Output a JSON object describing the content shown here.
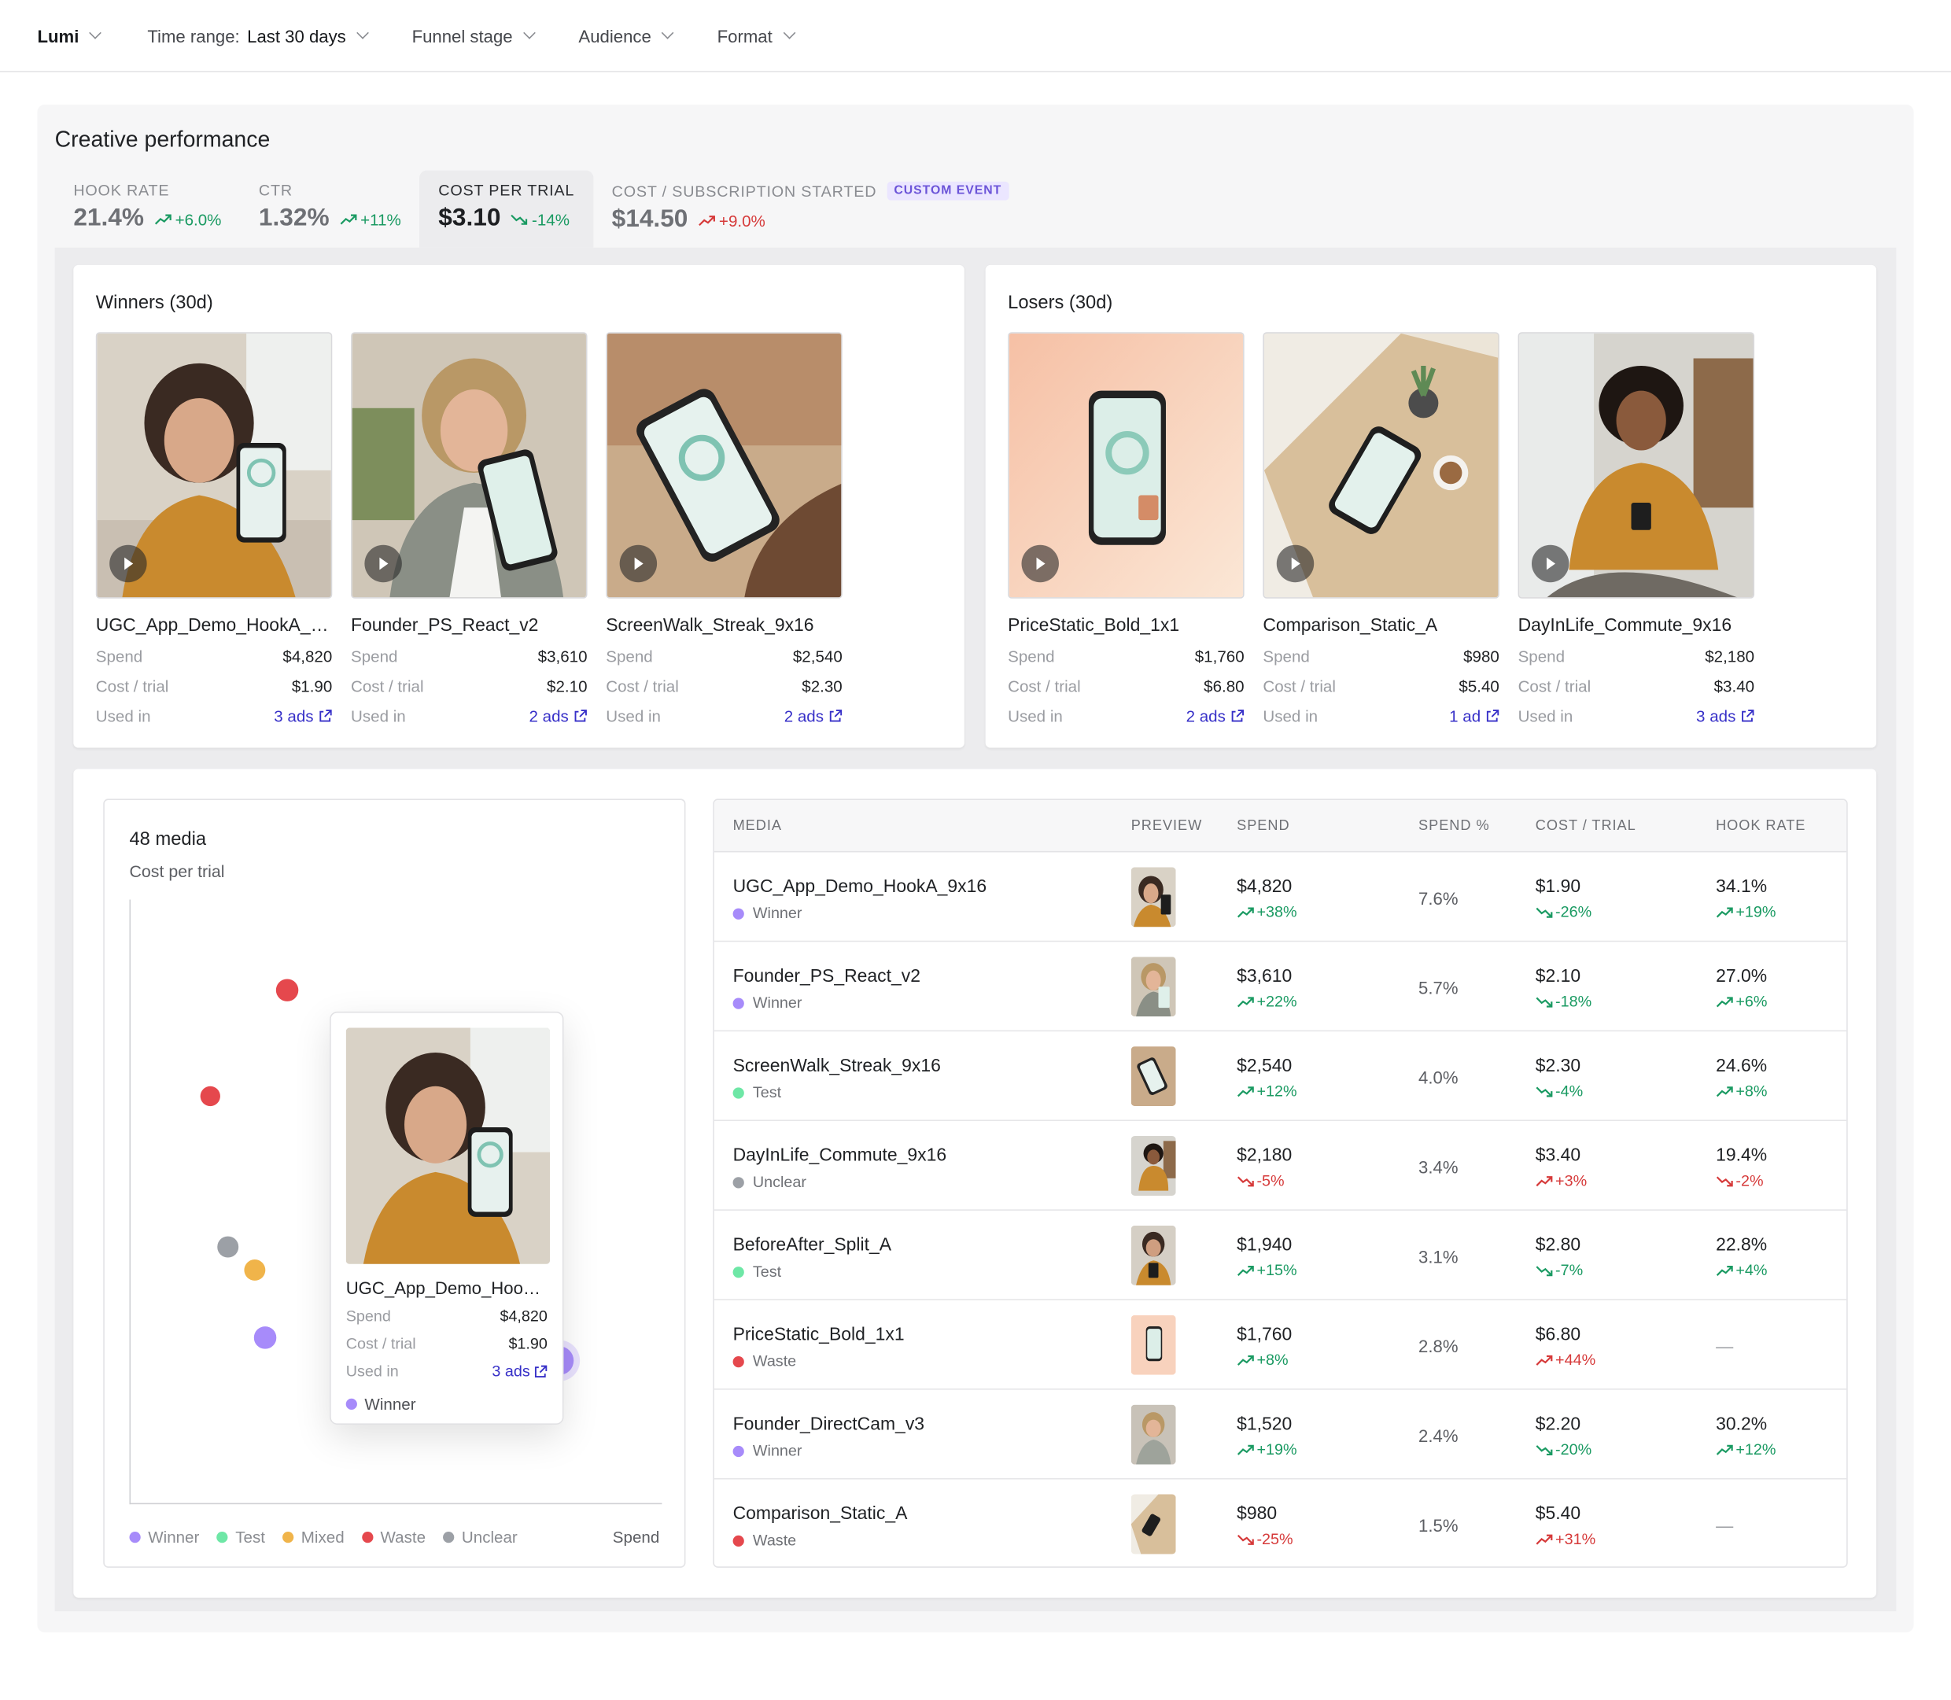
{
  "topbar": {
    "brand": "Lumi",
    "time_range_label": "Time range:",
    "time_range_value": "Last 30 days",
    "funnel_stage": "Funnel stage",
    "audience": "Audience",
    "format": "Format"
  },
  "panel": {
    "title": "Creative performance"
  },
  "metrics": [
    {
      "label": "HOOK RATE",
      "value": "21.4%",
      "delta": "+6.0%"
    },
    {
      "label": "CTR",
      "value": "1.32%",
      "delta": "+11%"
    },
    {
      "label": "COST PER TRIAL",
      "value": "$3.10",
      "delta": "-14%"
    },
    {
      "label": "COST / SUBSCRIPTION STARTED",
      "badge": "CUSTOM EVENT",
      "value": "$14.50",
      "delta": "+9.0%"
    }
  ],
  "labels": {
    "spend": "Spend",
    "cost_trial": "Cost / trial",
    "used_in": "Used in"
  },
  "winners": {
    "title": "Winners (30d)",
    "items": [
      {
        "name": "UGC_App_Demo_HookA_9x16",
        "spend": "$4,820",
        "cost": "$1.90",
        "used": "3 ads"
      },
      {
        "name": "Founder_PS_React_v2",
        "spend": "$3,610",
        "cost": "$2.10",
        "used": "2 ads"
      },
      {
        "name": "ScreenWalk_Streak_9x16",
        "spend": "$2,540",
        "cost": "$2.30",
        "used": "2 ads"
      }
    ]
  },
  "losers": {
    "title": "Losers (30d)",
    "items": [
      {
        "name": "PriceStatic_Bold_1x1",
        "spend": "$1,760",
        "cost": "$6.80",
        "used": "2 ads"
      },
      {
        "name": "Comparison_Static_A",
        "spend": "$980",
        "cost": "$5.40",
        "used": "1 ad"
      },
      {
        "name": "DayInLife_Commute_9x16",
        "spend": "$2,180",
        "cost": "$3.40",
        "used": "3 ads"
      }
    ]
  },
  "scatter": {
    "title": "48 media",
    "subtitle": "Cost per trial",
    "x_label": "Spend",
    "legend": [
      "Winner",
      "Test",
      "Mixed",
      "Waste",
      "Unclear"
    ],
    "colors": {
      "Winner": "#a78bfa",
      "Test": "#6ee7a6",
      "Mixed": "#f0b44a",
      "Waste": "#e5484d",
      "Unclear": "#9ca0a6"
    },
    "tooltip": {
      "name": "UGC_App_Demo_HookA_9x16",
      "spend": "$4,820",
      "cost": "$1.90",
      "used": "3 ads",
      "status": "Winner"
    }
  },
  "chart_data": {
    "type": "scatter",
    "title": "48 media",
    "ylabel": "Cost per trial",
    "xlabel": "Spend",
    "legend": [
      "Winner",
      "Test",
      "Mixed",
      "Waste",
      "Unclear"
    ],
    "series": [
      {
        "name": "Winner",
        "points": [
          {
            "x": 4820,
            "y": 1.9
          },
          {
            "x": 1520,
            "y": 2.2
          }
        ]
      },
      {
        "name": "Mixed",
        "points": [
          {
            "x": 1400,
            "y": 3.1
          }
        ]
      },
      {
        "name": "Unclear",
        "points": [
          {
            "x": 1100,
            "y": 3.4
          }
        ]
      },
      {
        "name": "Waste",
        "points": [
          {
            "x": 900,
            "y": 5.4
          },
          {
            "x": 1760,
            "y": 6.8
          }
        ]
      }
    ]
  },
  "table": {
    "headers": {
      "media": "MEDIA",
      "preview": "PREVIEW",
      "spend": "SPEND",
      "spend_pct": "SPEND %",
      "cost": "COST / TRIAL",
      "hook": "HOOK RATE"
    },
    "rows": [
      {
        "name": "UGC_App_Demo_HookA_9x16",
        "status": "Winner",
        "spend": "$4,820",
        "spend_delta": "+38%",
        "spend_pct": "7.6%",
        "cost": "$1.90",
        "cost_delta": "-26%",
        "hook": "34.1%",
        "hook_delta": "+19%"
      },
      {
        "name": "Founder_PS_React_v2",
        "status": "Winner",
        "spend": "$3,610",
        "spend_delta": "+22%",
        "spend_pct": "5.7%",
        "cost": "$2.10",
        "cost_delta": "-18%",
        "hook": "27.0%",
        "hook_delta": "+6%"
      },
      {
        "name": "ScreenWalk_Streak_9x16",
        "status": "Test",
        "spend": "$2,540",
        "spend_delta": "+12%",
        "spend_pct": "4.0%",
        "cost": "$2.30",
        "cost_delta": "-4%",
        "hook": "24.6%",
        "hook_delta": "+8%"
      },
      {
        "name": "DayInLife_Commute_9x16",
        "status": "Unclear",
        "spend": "$2,180",
        "spend_delta": "-5%",
        "spend_pct": "3.4%",
        "cost": "$3.40",
        "cost_delta": "+3%",
        "hook": "19.4%",
        "hook_delta": "-2%"
      },
      {
        "name": "BeforeAfter_Split_A",
        "status": "Test",
        "spend": "$1,940",
        "spend_delta": "+15%",
        "spend_pct": "3.1%",
        "cost": "$2.80",
        "cost_delta": "-7%",
        "hook": "22.8%",
        "hook_delta": "+4%"
      },
      {
        "name": "PriceStatic_Bold_1x1",
        "status": "Waste",
        "spend": "$1,760",
        "spend_delta": "+8%",
        "spend_pct": "2.8%",
        "cost": "$6.80",
        "cost_delta": "+44%",
        "hook": "—",
        "hook_delta": ""
      },
      {
        "name": "Founder_DirectCam_v3",
        "status": "Winner",
        "spend": "$1,520",
        "spend_delta": "+19%",
        "spend_pct": "2.4%",
        "cost": "$2.20",
        "cost_delta": "-20%",
        "hook": "30.2%",
        "hook_delta": "+12%"
      },
      {
        "name": "Comparison_Static_A",
        "status": "Waste",
        "spend": "$980",
        "spend_delta": "-25%",
        "spend_pct": "1.5%",
        "cost": "$5.40",
        "cost_delta": "+31%",
        "hook": "—",
        "hook_delta": ""
      }
    ]
  }
}
